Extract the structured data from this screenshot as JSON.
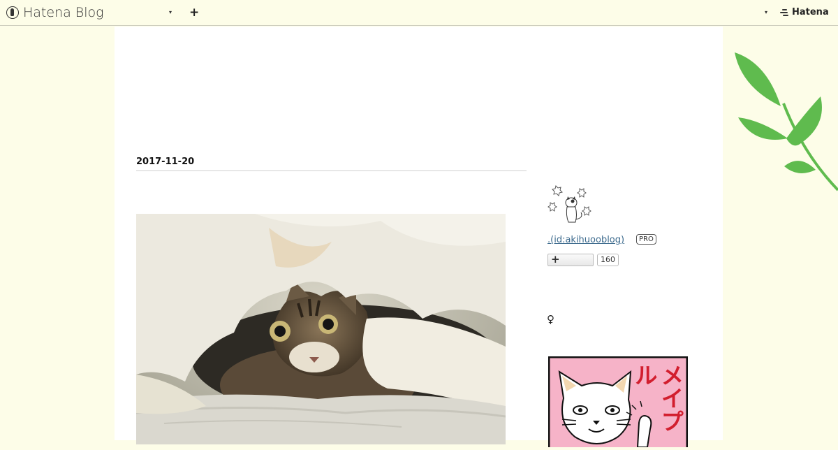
{
  "header": {
    "logo_text": "Hatena Blog",
    "caret_left": "▾",
    "plus": "+",
    "caret_right": "▾",
    "hatena_text": "Hatena"
  },
  "entry": {
    "date": "2017-11-20"
  },
  "sidebar": {
    "profile_id": ".(id:akihuooblog)",
    "pro_badge": "PRO",
    "subscribe_icon": "+",
    "subscriber_count": "160",
    "gender_symbol": "♀",
    "banner_text": "メイプル"
  },
  "colors": {
    "page_background": "#fdfde8",
    "link": "#3c6a8d",
    "leaf_green": "#5fbb4e",
    "banner_pink": "#f6b3c8",
    "banner_red": "#d21e2e"
  },
  "icons": {
    "logo": "hatena-blog-logo-icon",
    "hatena": "hatena-logo-icon",
    "leaf": "leaf-decoration-icon"
  }
}
